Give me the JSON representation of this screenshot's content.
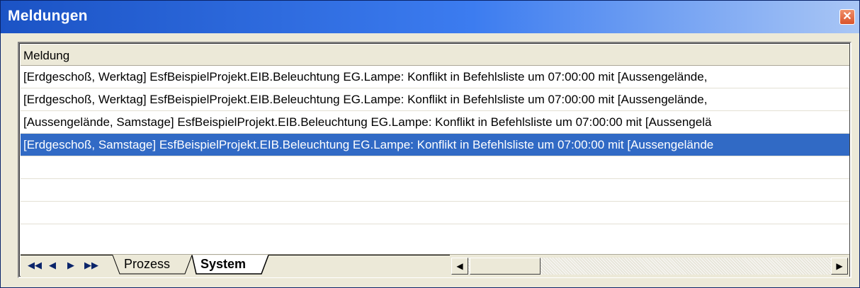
{
  "window": {
    "title": "Meldungen",
    "close_glyph": "✕"
  },
  "list": {
    "header": "Meldung",
    "rows": [
      {
        "text": "[Erdgeschoß, Werktag] EsfBeispielProjekt.EIB.Beleuchtung EG.Lampe: Konflikt in Befehlsliste um 07:00:00 mit [Aussengelände,",
        "selected": false
      },
      {
        "text": "[Erdgeschoß, Werktag] EsfBeispielProjekt.EIB.Beleuchtung EG.Lampe: Konflikt in Befehlsliste um 07:00:00 mit [Aussengelände,",
        "selected": false
      },
      {
        "text": "[Aussengelände, Samstage] EsfBeispielProjekt.EIB.Beleuchtung EG.Lampe: Konflikt in Befehlsliste um 07:00:00 mit [Aussengelä",
        "selected": false
      },
      {
        "text": "[Erdgeschoß, Samstage] EsfBeispielProjekt.EIB.Beleuchtung EG.Lampe: Konflikt in Befehlsliste um 07:00:00 mit [Aussengelände",
        "selected": true
      }
    ]
  },
  "tabs": {
    "items": [
      {
        "label": "Prozess",
        "active": false
      },
      {
        "label": "System",
        "active": true
      }
    ]
  },
  "nav": {
    "first": "◀◀",
    "prev": "◀",
    "next": "▶",
    "last": "▶▶"
  },
  "scrollbar": {
    "left_glyph": "◀",
    "right_glyph": "▶"
  },
  "colors": {
    "selection": "#316ac5",
    "title_start": "#1b53c5",
    "title_end": "#a9c6f5"
  }
}
